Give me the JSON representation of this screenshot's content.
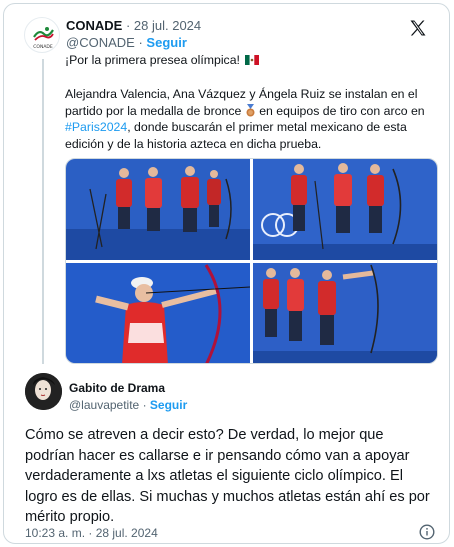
{
  "quoted_tweet": {
    "author_name": "CONADE",
    "date": "· 28 jul. 2024",
    "handle": "@CONADE",
    "separator": "·",
    "follow_label": "Seguir",
    "text_line1": "¡Por la primera presea olímpica!",
    "text_part1": "Alejandra Valencia, Ana Vázquez y Ángela Ruiz se instalan en el partido por la medalla de bronce ",
    "text_part2": " en equipos de tiro con arco en ",
    "hashtag": "#Paris2024",
    "text_part3": ", donde buscarán el primer metal mexicano de esta edición y de la historia azteca en dicha prueba.",
    "avatar_label": "CONADE",
    "icons": [
      "mexico-flag-icon",
      "bronze-medal-icon",
      "x-logo-icon"
    ]
  },
  "reply_tweet": {
    "author_name": "Gabito de Drama",
    "handle": "@lauvapetite",
    "separator": "·",
    "follow_label": "Seguir",
    "text": "Cómo se atreven a decir esto? De verdad, lo mejor que podrían hacer es callarse e ir pensando cómo van a apoyar verdaderamente a lxs atletas el siguiente ciclo olímpico. El logro es de ellas. Si muchas y muchos atletas están ahí es por mérito propio.",
    "timestamp": "10:23 a. m. · 28 jul. 2024",
    "icons": [
      "info-icon"
    ]
  },
  "colors": {
    "link_blue": "#1d9bf0",
    "text_primary": "#0f1419",
    "text_secondary": "#536471",
    "border": "#cfd9de"
  }
}
